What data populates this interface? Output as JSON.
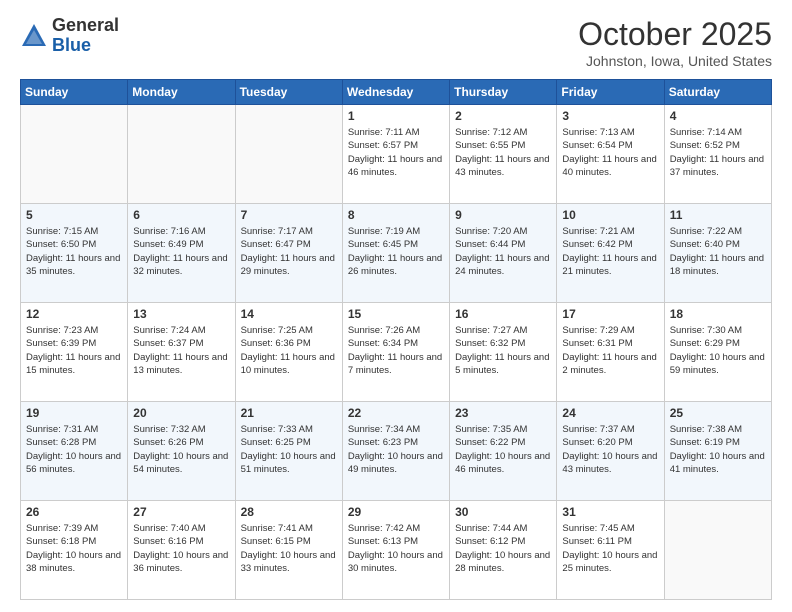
{
  "header": {
    "logo_general": "General",
    "logo_blue": "Blue",
    "month": "October 2025",
    "location": "Johnston, Iowa, United States"
  },
  "days_of_week": [
    "Sunday",
    "Monday",
    "Tuesday",
    "Wednesday",
    "Thursday",
    "Friday",
    "Saturday"
  ],
  "weeks": [
    [
      {
        "day": "",
        "info": ""
      },
      {
        "day": "",
        "info": ""
      },
      {
        "day": "",
        "info": ""
      },
      {
        "day": "1",
        "info": "Sunrise: 7:11 AM\nSunset: 6:57 PM\nDaylight: 11 hours and 46 minutes."
      },
      {
        "day": "2",
        "info": "Sunrise: 7:12 AM\nSunset: 6:55 PM\nDaylight: 11 hours and 43 minutes."
      },
      {
        "day": "3",
        "info": "Sunrise: 7:13 AM\nSunset: 6:54 PM\nDaylight: 11 hours and 40 minutes."
      },
      {
        "day": "4",
        "info": "Sunrise: 7:14 AM\nSunset: 6:52 PM\nDaylight: 11 hours and 37 minutes."
      }
    ],
    [
      {
        "day": "5",
        "info": "Sunrise: 7:15 AM\nSunset: 6:50 PM\nDaylight: 11 hours and 35 minutes."
      },
      {
        "day": "6",
        "info": "Sunrise: 7:16 AM\nSunset: 6:49 PM\nDaylight: 11 hours and 32 minutes."
      },
      {
        "day": "7",
        "info": "Sunrise: 7:17 AM\nSunset: 6:47 PM\nDaylight: 11 hours and 29 minutes."
      },
      {
        "day": "8",
        "info": "Sunrise: 7:19 AM\nSunset: 6:45 PM\nDaylight: 11 hours and 26 minutes."
      },
      {
        "day": "9",
        "info": "Sunrise: 7:20 AM\nSunset: 6:44 PM\nDaylight: 11 hours and 24 minutes."
      },
      {
        "day": "10",
        "info": "Sunrise: 7:21 AM\nSunset: 6:42 PM\nDaylight: 11 hours and 21 minutes."
      },
      {
        "day": "11",
        "info": "Sunrise: 7:22 AM\nSunset: 6:40 PM\nDaylight: 11 hours and 18 minutes."
      }
    ],
    [
      {
        "day": "12",
        "info": "Sunrise: 7:23 AM\nSunset: 6:39 PM\nDaylight: 11 hours and 15 minutes."
      },
      {
        "day": "13",
        "info": "Sunrise: 7:24 AM\nSunset: 6:37 PM\nDaylight: 11 hours and 13 minutes."
      },
      {
        "day": "14",
        "info": "Sunrise: 7:25 AM\nSunset: 6:36 PM\nDaylight: 11 hours and 10 minutes."
      },
      {
        "day": "15",
        "info": "Sunrise: 7:26 AM\nSunset: 6:34 PM\nDaylight: 11 hours and 7 minutes."
      },
      {
        "day": "16",
        "info": "Sunrise: 7:27 AM\nSunset: 6:32 PM\nDaylight: 11 hours and 5 minutes."
      },
      {
        "day": "17",
        "info": "Sunrise: 7:29 AM\nSunset: 6:31 PM\nDaylight: 11 hours and 2 minutes."
      },
      {
        "day": "18",
        "info": "Sunrise: 7:30 AM\nSunset: 6:29 PM\nDaylight: 10 hours and 59 minutes."
      }
    ],
    [
      {
        "day": "19",
        "info": "Sunrise: 7:31 AM\nSunset: 6:28 PM\nDaylight: 10 hours and 56 minutes."
      },
      {
        "day": "20",
        "info": "Sunrise: 7:32 AM\nSunset: 6:26 PM\nDaylight: 10 hours and 54 minutes."
      },
      {
        "day": "21",
        "info": "Sunrise: 7:33 AM\nSunset: 6:25 PM\nDaylight: 10 hours and 51 minutes."
      },
      {
        "day": "22",
        "info": "Sunrise: 7:34 AM\nSunset: 6:23 PM\nDaylight: 10 hours and 49 minutes."
      },
      {
        "day": "23",
        "info": "Sunrise: 7:35 AM\nSunset: 6:22 PM\nDaylight: 10 hours and 46 minutes."
      },
      {
        "day": "24",
        "info": "Sunrise: 7:37 AM\nSunset: 6:20 PM\nDaylight: 10 hours and 43 minutes."
      },
      {
        "day": "25",
        "info": "Sunrise: 7:38 AM\nSunset: 6:19 PM\nDaylight: 10 hours and 41 minutes."
      }
    ],
    [
      {
        "day": "26",
        "info": "Sunrise: 7:39 AM\nSunset: 6:18 PM\nDaylight: 10 hours and 38 minutes."
      },
      {
        "day": "27",
        "info": "Sunrise: 7:40 AM\nSunset: 6:16 PM\nDaylight: 10 hours and 36 minutes."
      },
      {
        "day": "28",
        "info": "Sunrise: 7:41 AM\nSunset: 6:15 PM\nDaylight: 10 hours and 33 minutes."
      },
      {
        "day": "29",
        "info": "Sunrise: 7:42 AM\nSunset: 6:13 PM\nDaylight: 10 hours and 30 minutes."
      },
      {
        "day": "30",
        "info": "Sunrise: 7:44 AM\nSunset: 6:12 PM\nDaylight: 10 hours and 28 minutes."
      },
      {
        "day": "31",
        "info": "Sunrise: 7:45 AM\nSunset: 6:11 PM\nDaylight: 10 hours and 25 minutes."
      },
      {
        "day": "",
        "info": ""
      }
    ]
  ]
}
